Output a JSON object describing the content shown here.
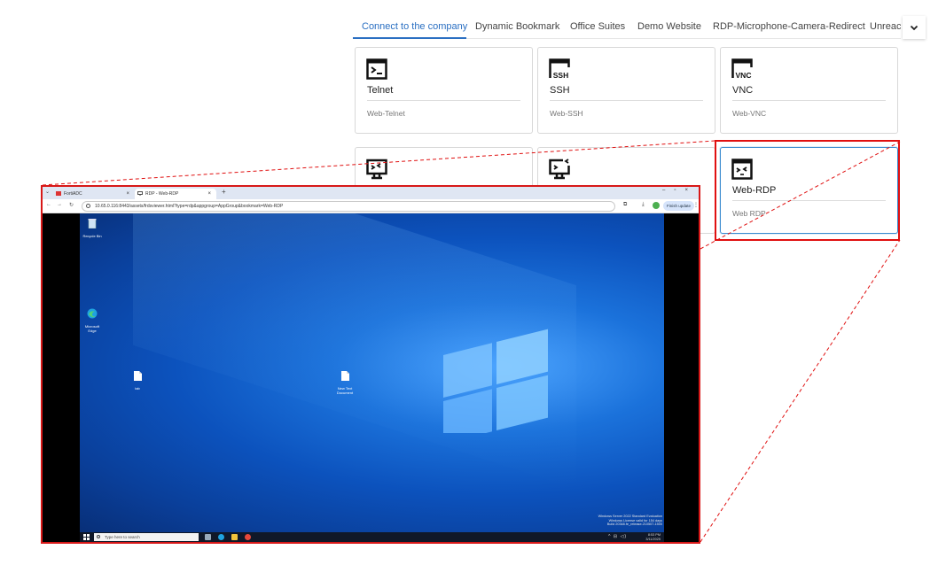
{
  "portal": {
    "tabs": [
      {
        "label": "Connect to the company",
        "active": true
      },
      {
        "label": "Dynamic Bookmark",
        "active": false
      },
      {
        "label": "Office Suites",
        "active": false
      },
      {
        "label": "Demo Website",
        "active": false
      },
      {
        "label": "RDP-Microphone-Camera-Redirect",
        "active": false
      },
      {
        "label": "Unreachable",
        "active": false
      }
    ],
    "more_icon": "chevron-down-icon",
    "accent_color": "#2a6fc2",
    "cards": [
      {
        "title": "Telnet",
        "subtitle": "Web-Telnet",
        "icon": "terminal-icon"
      },
      {
        "title": "SSH",
        "subtitle": "Web-SSH",
        "icon": "ssh-terminal-icon",
        "icon_text": "SSH"
      },
      {
        "title": "VNC",
        "subtitle": "Web-VNC",
        "icon": "vnc-terminal-icon",
        "icon_text": "VNC"
      },
      {
        "title": "",
        "subtitle": "",
        "icon": "remote-desktop-icon"
      },
      {
        "title": "",
        "subtitle": "",
        "icon": "remote-desktop-icon"
      },
      {
        "title": "Web-RDP",
        "subtitle": "Web RDP",
        "icon": "rdp-window-icon",
        "selected": true
      }
    ],
    "highlight_color": "#e01010"
  },
  "browser": {
    "tabs": [
      {
        "label": "FortiADC",
        "active": false,
        "icon": "fortiadc-favicon"
      },
      {
        "label": "RDP - Web-RDP",
        "active": true,
        "icon": "monitor-favicon"
      }
    ],
    "url": "10.65.0.116:8443/assets/frdsviewer.html?type=rdp&appgroup=AppGroup&bookmark=Web-RDP",
    "finish_update_label": "Finish update",
    "profile_initial": "",
    "window_controls": [
      "minimize-icon",
      "restore-icon",
      "close-icon"
    ]
  },
  "remote_desktop": {
    "icons": [
      {
        "label": "Recycle Bin",
        "icon": "recycle-bin-icon"
      },
      {
        "label": "Microsoft Edge",
        "icon": "edge-icon"
      },
      {
        "label": "tab",
        "icon": "document-icon"
      },
      {
        "label": "New Text Document",
        "icon": "document-icon"
      }
    ],
    "watermark": [
      "Windows Server 2022 Standard Evaluation",
      "Windows License valid for 154 days",
      "Build 20348.fe_release.210507-1500"
    ],
    "taskbar": {
      "search_placeholder": "Type here to search",
      "time": "8:53 PM",
      "date": "3/11/2025"
    }
  }
}
